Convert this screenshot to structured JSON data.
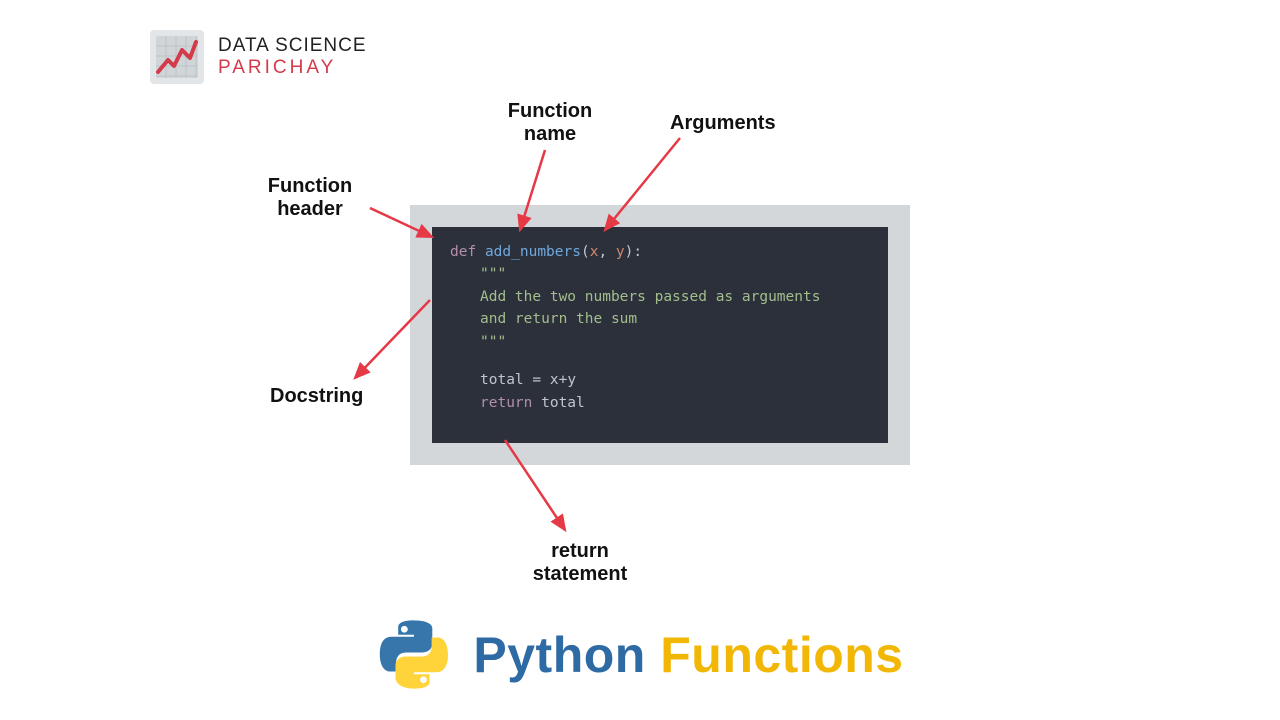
{
  "brand": {
    "line1": "DATA SCIENCE",
    "line2": "PARICHAY"
  },
  "annotations": {
    "function_name": "Function\nname",
    "arguments": "Arguments",
    "function_header": "Function\nheader",
    "docstring": "Docstring",
    "return_statement": "return\nstatement"
  },
  "code": {
    "kw_def": "def",
    "func_name": "add_numbers",
    "params_open": "(",
    "param_x": "x",
    "param_sep": ", ",
    "param_y": "y",
    "params_close": "):",
    "triple_quote": "\"\"\"",
    "doc_line1": "Add the two numbers passed as arguments",
    "doc_line2": "and return the sum",
    "assign_var": "total",
    "assign_eq": " = ",
    "assign_expr_x": "x",
    "assign_plus": "+",
    "assign_expr_y": "y",
    "kw_return": "return",
    "return_val": " total"
  },
  "title": {
    "word1": "Python",
    "word2": "Functions"
  },
  "colors": {
    "arrow": "#e63946",
    "code_bg": "#2b303b",
    "stamp_bg": "#d3d7da",
    "brand_accent": "#d33a4a",
    "title_blue": "#2e6aa3",
    "title_yellow": "#f2b705",
    "python_blue": "#3776ab",
    "python_yellow": "#ffd43b"
  }
}
